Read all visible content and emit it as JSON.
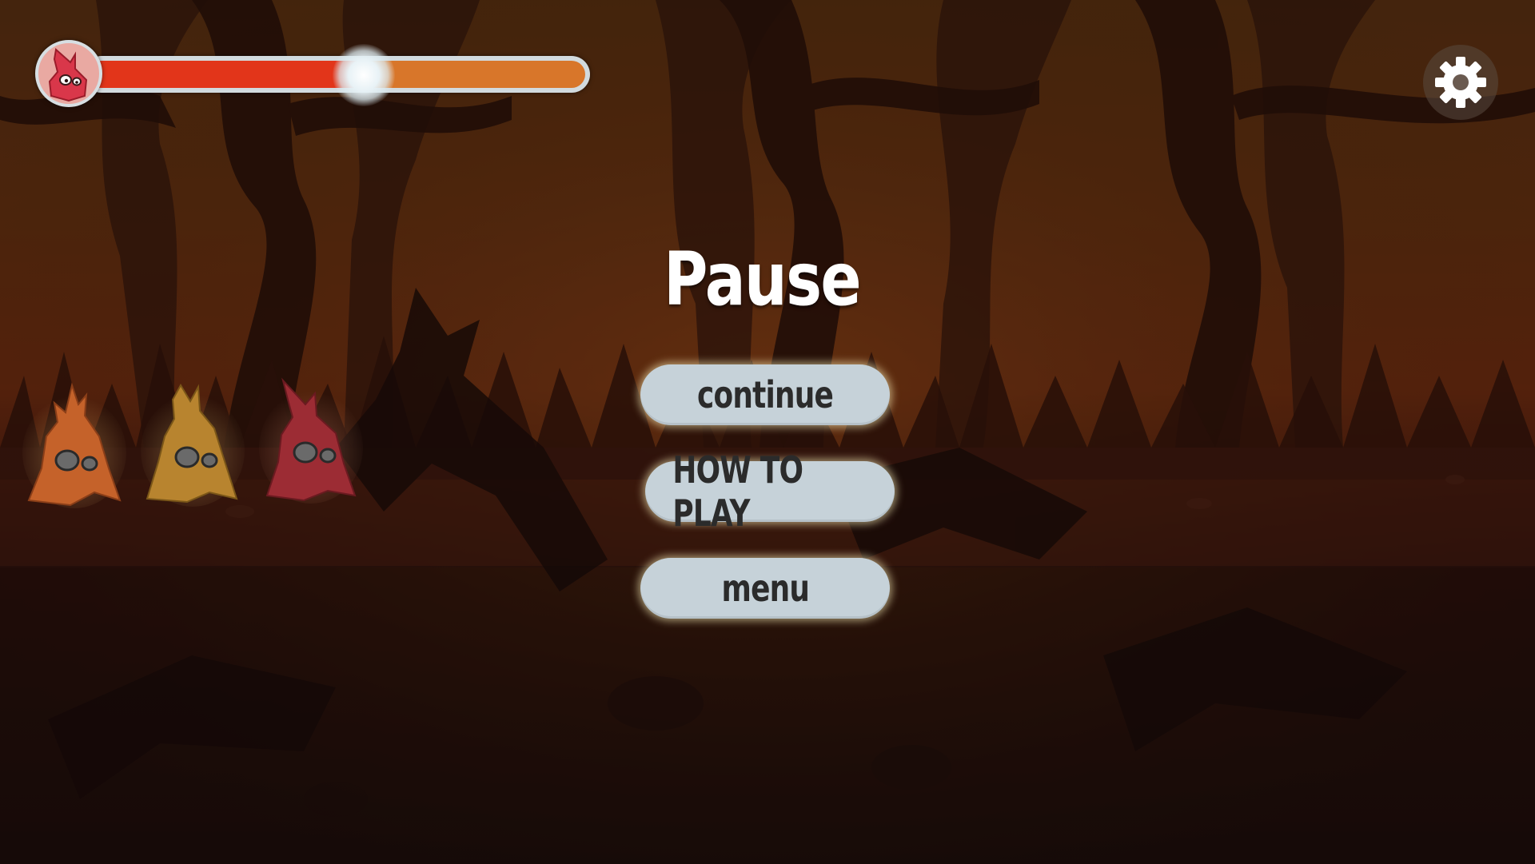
{
  "pause_menu": {
    "title": "Pause",
    "buttons": {
      "continue": "continue",
      "how_to_play": "HOW TO PLAY",
      "menu": "menu"
    }
  },
  "hud": {
    "progress_fraction": 0.555,
    "progress_fill_color": "#e2351a",
    "progress_remaining_color": "#d8762a",
    "player_badge_icon": "red-flame-creature-icon",
    "settings_icon": "gear-icon"
  },
  "creatures": [
    {
      "name": "orange-flame-creature",
      "color": "#c5622a"
    },
    {
      "name": "yellow-flame-creature",
      "color": "#b8842f"
    },
    {
      "name": "red-flame-creature",
      "color": "#9c2c34"
    }
  ]
}
